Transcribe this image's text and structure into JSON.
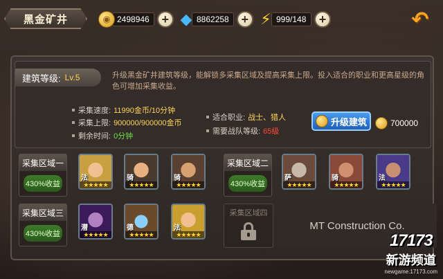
{
  "header": {
    "title": "黑金矿井",
    "gold": "2498946",
    "diamonds": "8862258",
    "energy": "999/148",
    "back_label": "↶"
  },
  "building": {
    "level_label": "建筑等级:",
    "level_value": "Lv.5",
    "description": "升级黑金矿井建筑等级，能解锁多采集区域及提高采集上限。投入适合的职业和更高星级的角色可增加采集收益。",
    "speed_label": "采集速度:",
    "speed_value": "11990金币/10分钟",
    "limit_label": "采集上限:",
    "limit_value": "900000/900000金币",
    "remaining_label": "剩余时间:",
    "remaining_value": "0分钟",
    "job_label": "适合职业:",
    "job_value": "战士、猎人",
    "team_level_label": "需要战队等级:",
    "team_level_value": "65级",
    "upgrade_button": "升级建筑",
    "upgrade_cost": "700000"
  },
  "zones": [
    {
      "name": "采集区域一",
      "yield": "430%收益"
    },
    {
      "name": "采集区域二",
      "yield": "430%收益"
    },
    {
      "name": "采集区域三",
      "yield": "430%收益"
    },
    {
      "name": "采集区域四",
      "locked_text": "MT Construction Co."
    }
  ],
  "heroes": [
    {
      "cls": "法",
      "stars": "★★★★★",
      "color": "#c9a040"
    },
    {
      "cls": "骑",
      "stars": "★★★★★",
      "color": "#7a5a3a"
    },
    {
      "cls": "骑",
      "stars": "★★★★★",
      "color": "#a06a3a"
    },
    {
      "cls": "萨",
      "stars": "★★★★★",
      "color": "#6a4a3a"
    },
    {
      "cls": "骑",
      "stars": "★★★★★",
      "color": "#8a4a3a"
    },
    {
      "cls": "法",
      "stars": "★★★★★",
      "color": "#4a3a8a"
    },
    {
      "cls": "潜",
      "stars": "★★★★★",
      "color": "#6a2a8a"
    },
    {
      "cls": "德",
      "stars": "★★★★★",
      "color": "#3a5a7a"
    },
    {
      "cls": "法",
      "stars": "★★★★★",
      "color": "#c9a030"
    }
  ],
  "watermark": {
    "logo": "17173",
    "sub": "新游频道",
    "url": "newgame.17173.com"
  }
}
